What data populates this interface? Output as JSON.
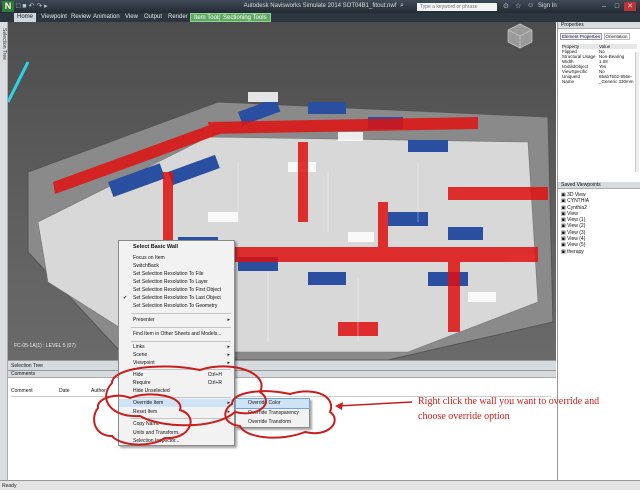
{
  "window": {
    "title": "Autodesk Navisworks Simulate 2014   SOT04B1_fitout.nwf",
    "search_placeholder": "Type a keyword or phrase",
    "sign_in": "Sign In",
    "app_letter": "N"
  },
  "ribbon": {
    "tabs": [
      "Home",
      "Viewpoint",
      "Review",
      "Animation",
      "View",
      "Output",
      "Render"
    ],
    "context_tabs": [
      "Item Tools",
      "Sectioning Tools"
    ]
  },
  "left_strip": {
    "label": "Selection Tree"
  },
  "viewport": {
    "floor_label": "FC-05-1A(1) : LEVEL 5 (07)",
    "viewcube_label": "TOP"
  },
  "properties_panel": {
    "title": "Properties",
    "tabs": [
      "Element Properties",
      "Orientation"
    ],
    "columns": [
      "Property",
      "Value"
    ],
    "rows": [
      [
        "Flipped",
        "No"
      ],
      [
        "Structural Usage",
        "Non-Bearing"
      ],
      [
        "Width",
        "1.08"
      ],
      [
        "IsValidObject",
        "Yes"
      ],
      [
        "ViewSpecific",
        "No"
      ],
      [
        "UniqueId",
        "85ab7502-956e-"
      ],
      [
        "Name",
        "_Generic 330mm"
      ]
    ]
  },
  "saved_viewpoints": {
    "title": "Saved Viewpoints",
    "items": [
      "3D View",
      "CYNTHIA",
      "Cynthia2",
      "View",
      "View (1)",
      "View (2)",
      "View (3)",
      "View (4)",
      "View (5)",
      "therapy"
    ]
  },
  "comments_panel": {
    "title": "Comments",
    "tabs": [
      "Selection Tree"
    ],
    "columns": [
      "Comment",
      "Date",
      "Author"
    ]
  },
  "context_menu": {
    "items": [
      {
        "label": "Select Basic Wall",
        "header": true
      },
      {
        "label": "Focus on Item"
      },
      {
        "label": "SwitchBack"
      },
      {
        "label": "Set Selection Resolution To File"
      },
      {
        "label": "Set Selection Resolution To Layer"
      },
      {
        "label": "Set Selection Resolution To First Object"
      },
      {
        "label": "Set Selection Resolution To Last Object",
        "checked": true
      },
      {
        "label": "Set Selection Resolution To Geometry"
      },
      {
        "label": "Presenter",
        "submenu": true
      },
      {
        "label": "Find Item in Other Sheets and Models..."
      },
      {
        "label": "Links",
        "submenu": true
      },
      {
        "label": "Scene",
        "submenu": true
      },
      {
        "label": "Viewpoint",
        "submenu": true
      },
      {
        "label": "Hide",
        "shortcut": "Ctrl+H"
      },
      {
        "label": "Require",
        "shortcut": "Ctrl+R"
      },
      {
        "label": "Hide Unselected"
      },
      {
        "label": "Override Item",
        "submenu": true,
        "highlight": true
      },
      {
        "label": "Reset Item",
        "submenu": true
      },
      {
        "label": "Copy Name"
      },
      {
        "label": "Units and Transform..."
      },
      {
        "label": "Selection Inspector..."
      }
    ]
  },
  "submenu": {
    "items": [
      "Override Color",
      "Override Transparency",
      "Override Transform"
    ]
  },
  "annotation": {
    "line1": "Right click the wall you want to override and",
    "line2": "choose override option"
  },
  "status_bar": {
    "text": "Ready"
  },
  "colors": {
    "wall_red": "#e01010",
    "annotation_red": "#c81e1e",
    "ribbon_dark": "#2c3540",
    "context_tab_green": "#5fa863"
  }
}
